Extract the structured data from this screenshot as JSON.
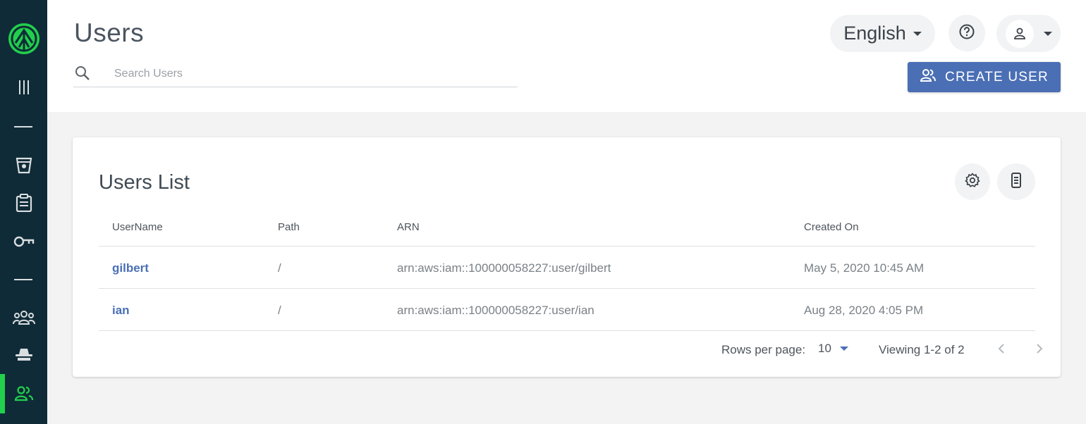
{
  "header": {
    "title": "Users",
    "search_placeholder": "Search Users",
    "language": "English",
    "create_user_label": "CREATE USER"
  },
  "card": {
    "title": "Users List",
    "columns": [
      "UserName",
      "Path",
      "ARN",
      "Created On"
    ],
    "rows": [
      {
        "username": "gilbert",
        "path": "/",
        "arn": "arn:aws:iam::100000058227:user/gilbert",
        "created_on": "May 5, 2020 10:45 AM"
      },
      {
        "username": "ian",
        "path": "/",
        "arn": "arn:aws:iam::100000058227:user/ian",
        "created_on": "Aug 28, 2020 4:05 PM"
      }
    ]
  },
  "pagination": {
    "rows_per_page_label": "Rows per page:",
    "rows_per_page_value": "10",
    "viewing_label": "Viewing 1-2 of 2"
  },
  "sidebar": {
    "items": [
      "logo-icon",
      "menu-toggle-icon",
      "buckets-icon",
      "clipboard-icon",
      "key-icon",
      "groups-icon",
      "detective-icon",
      "users-icon"
    ],
    "active_item": "users-icon"
  },
  "colors": {
    "sidebar_bg": "#0f2b37",
    "accent": "#4a6fb5",
    "active_indicator": "#21d04c"
  }
}
